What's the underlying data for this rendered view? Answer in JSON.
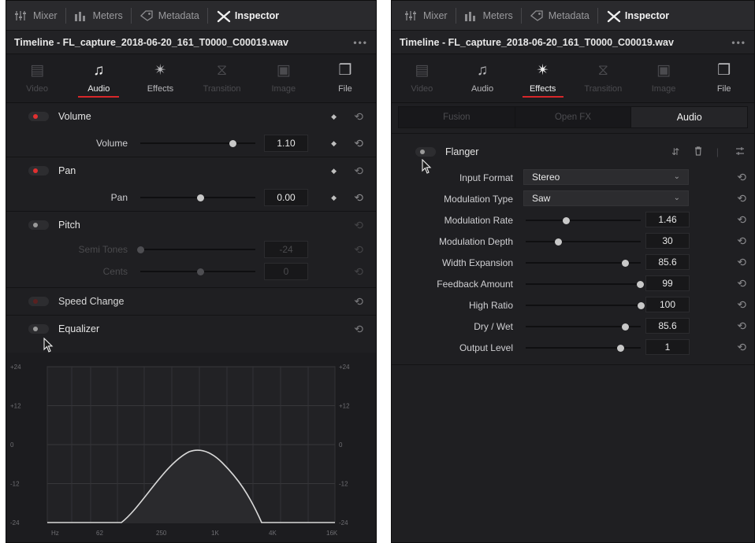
{
  "left": {
    "topbar": {
      "mixer": "Mixer",
      "meters": "Meters",
      "metadata": "Metadata",
      "inspector": "Inspector"
    },
    "title": "Timeline - FL_capture_2018-06-20_161_T0000_C00019.wav",
    "more": "•••",
    "tabs": [
      {
        "label": "Video",
        "icon": "video-icon",
        "glyph": "▤"
      },
      {
        "label": "Audio",
        "icon": "audio-note-icon",
        "glyph": "♫"
      },
      {
        "label": "Effects",
        "icon": "magic-wand-icon",
        "glyph": "✴"
      },
      {
        "label": "Transition",
        "icon": "transition-icon",
        "glyph": "⧖"
      },
      {
        "label": "Image",
        "icon": "image-icon",
        "glyph": "▣"
      },
      {
        "label": "File",
        "icon": "file-icon",
        "glyph": "❒"
      }
    ],
    "volume": {
      "section": "Volume",
      "param": "Volume",
      "value": "1.10",
      "level": 0.8
    },
    "pan": {
      "section": "Pan",
      "param": "Pan",
      "value": "0.00",
      "level": 0.52
    },
    "pitch": {
      "section": "Pitch",
      "semitones_label": "Semi Tones",
      "semitones": "-24",
      "semitones_level": 0.0,
      "cents_label": "Cents",
      "cents": "0",
      "cents_level": 0.52
    },
    "speed": {
      "section": "Speed Change"
    },
    "equalizer": {
      "section": "Equalizer",
      "y_ticks": [
        "+24",
        "+12",
        "0",
        "-12",
        "-24"
      ],
      "x_ticks": [
        "Hz",
        "62",
        "250",
        "1K",
        "4K",
        "16K"
      ]
    }
  },
  "right": {
    "topbar": {
      "mixer": "Mixer",
      "meters": "Meters",
      "metadata": "Metadata",
      "inspector": "Inspector"
    },
    "title": "Timeline - FL_capture_2018-06-20_161_T0000_C00019.wav",
    "more": "•••",
    "tabs": [
      {
        "label": "Video",
        "icon": "video-icon",
        "glyph": "▤"
      },
      {
        "label": "Audio",
        "icon": "audio-note-icon",
        "glyph": "♫"
      },
      {
        "label": "Effects",
        "icon": "magic-wand-icon",
        "glyph": "✴"
      },
      {
        "label": "Transition",
        "icon": "transition-icon",
        "glyph": "⧖"
      },
      {
        "label": "Image",
        "icon": "image-icon",
        "glyph": "▣"
      },
      {
        "label": "File",
        "icon": "file-icon",
        "glyph": "❒"
      }
    ],
    "subtabs": [
      "Fusion",
      "Open FX",
      "Audio"
    ],
    "flanger": {
      "title": "Flanger",
      "input_format_label": "Input Format",
      "input_format": "Stereo",
      "modulation_type_label": "Modulation Type",
      "modulation_type": "Saw",
      "params": [
        {
          "label": "Modulation Rate",
          "value": "1.46",
          "level": 0.35
        },
        {
          "label": "Modulation Depth",
          "value": "30",
          "level": 0.28
        },
        {
          "label": "Width Expansion",
          "value": "85.6",
          "level": 0.86
        },
        {
          "label": "Feedback Amount",
          "value": "99",
          "level": 0.99
        },
        {
          "label": "High Ratio",
          "value": "100",
          "level": 1.0
        },
        {
          "label": "Dry / Wet",
          "value": "85.6",
          "level": 0.86
        },
        {
          "label": "Output Level",
          "value": "1",
          "level": 0.82
        }
      ]
    }
  },
  "colors": {
    "accent": "#d7272a",
    "panel": "#1f1f22",
    "topbar": "#2a2a2d"
  }
}
